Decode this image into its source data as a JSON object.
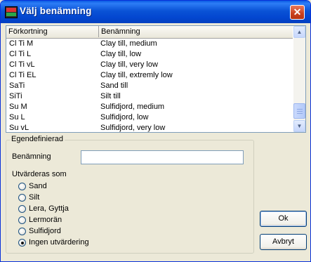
{
  "window": {
    "title": "Välj benämning"
  },
  "list": {
    "columns": [
      "Förkortning",
      "Benämning"
    ],
    "rows": [
      [
        "Cl Ti M",
        "Clay till, medium"
      ],
      [
        "Cl Ti L",
        "Clay till, low"
      ],
      [
        "Cl Ti vL",
        "Clay till, very low"
      ],
      [
        "Cl Ti EL",
        "Clay till, extremly low"
      ],
      [
        "SaTi",
        "Sand till"
      ],
      [
        "SiTi",
        "Silt till"
      ],
      [
        "Su M",
        "Sulfidjord, medium"
      ],
      [
        "Su L",
        "Sulfidjord, low"
      ],
      [
        "Su vL",
        "Sulfidjord, very low"
      ]
    ]
  },
  "custom": {
    "legend": "Egendefinierad",
    "name_label": "Benämning",
    "name_value": "",
    "eval_label": "Utvärderas som",
    "options": [
      {
        "label": "Sand",
        "checked": false
      },
      {
        "label": "Silt",
        "checked": false
      },
      {
        "label": "Lera, Gyttja",
        "checked": false
      },
      {
        "label": "Lermorän",
        "checked": false
      },
      {
        "label": "Sulfidjord",
        "checked": false
      },
      {
        "label": "Ingen utvärdering",
        "checked": true
      }
    ]
  },
  "buttons": {
    "ok": "Ok",
    "cancel": "Avbryt"
  },
  "icons": {
    "app": "app-icon",
    "close": "close-icon",
    "scroll_up": "arrow-up-icon",
    "scroll_down": "arrow-down-icon"
  }
}
